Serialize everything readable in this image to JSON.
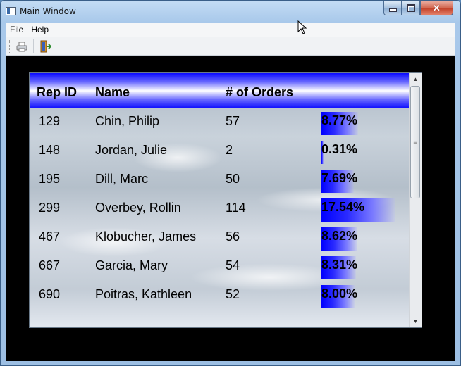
{
  "window": {
    "title": "Main Window"
  },
  "menu": {
    "items": [
      "File",
      "Help"
    ]
  },
  "toolbar": {
    "buttons": [
      "print-icon",
      "exit-door-icon"
    ]
  },
  "table": {
    "headers": {
      "rep_id": "Rep ID",
      "name": "Name",
      "orders": "# of Orders"
    },
    "rows": [
      {
        "rep_id": "129",
        "name": "Chin, Philip",
        "orders": "57",
        "percent": "8.77%",
        "share": 0.0877
      },
      {
        "rep_id": "148",
        "name": "Jordan, Julie",
        "orders": "2",
        "percent": "0.31%",
        "share": 0.0031
      },
      {
        "rep_id": "195",
        "name": "Dill, Marc",
        "orders": "50",
        "percent": "7.69%",
        "share": 0.0769
      },
      {
        "rep_id": "299",
        "name": "Overbey, Rollin",
        "orders": "114",
        "percent": "17.54%",
        "share": 0.1754
      },
      {
        "rep_id": "467",
        "name": "Klobucher, James",
        "orders": "56",
        "percent": "8.62%",
        "share": 0.0862
      },
      {
        "rep_id": "667",
        "name": "Garcia, Mary",
        "orders": "54",
        "percent": "8.31%",
        "share": 0.0831
      },
      {
        "rep_id": "690",
        "name": "Poitras, Kathleen",
        "orders": "52",
        "percent": "8.00%",
        "share": 0.08
      }
    ]
  },
  "colors": {
    "header_gradient": "#0a0aff",
    "bar_fill": "#0000ff",
    "client_bg": "#000000"
  }
}
